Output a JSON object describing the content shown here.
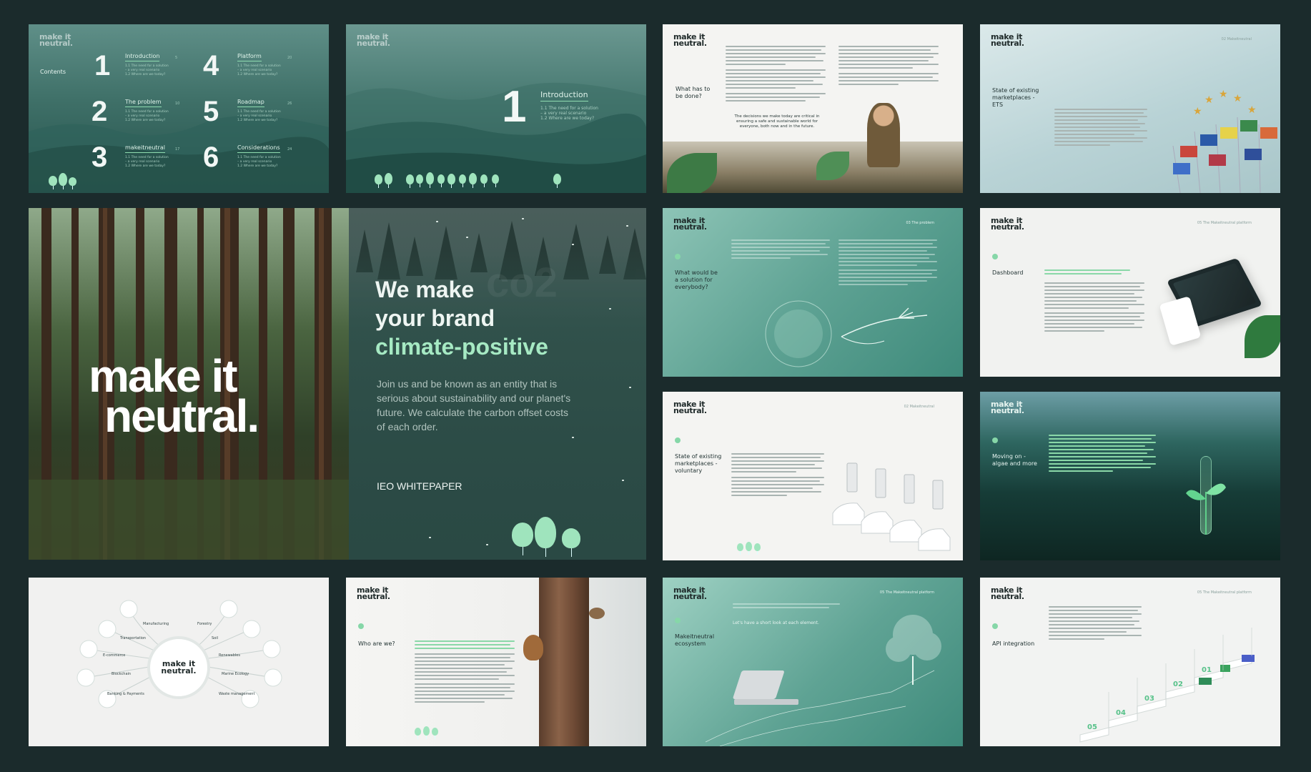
{
  "slides": {
    "contents": {
      "logo": [
        "make it",
        "neutral."
      ],
      "heading": "Contents",
      "items": [
        {
          "num": "1",
          "label": "Introduction",
          "page": "5",
          "sub": [
            "1.1  The need for a solution",
            "– a very real scenario",
            "1.2  Where are we today?"
          ]
        },
        {
          "num": "2",
          "label": "The problem",
          "page": "10",
          "sub": [
            "1.1  The need for a solution",
            "– a very real scenario",
            "1.2  Where are we today?"
          ]
        },
        {
          "num": "3",
          "label": "makeitneutral",
          "page": "17",
          "sub": [
            "1.1  The need for a solution",
            "– a very real scenario",
            "1.2  Where are we today?"
          ]
        },
        {
          "num": "4",
          "label": "Platform",
          "page": "20",
          "sub": [
            "1.1  The need for a solution",
            "– a very real scenario",
            "1.2  Where are we today?"
          ]
        },
        {
          "num": "5",
          "label": "Roadmap",
          "page": "26",
          "sub": [
            "1.1  The need for a solution",
            "– a very real scenario",
            "1.2  Where are we today?"
          ]
        },
        {
          "num": "6",
          "label": "Considerations",
          "page": "24",
          "sub": [
            "1.1  The need for a solution",
            "– a very real scenario",
            "1.2  Where are we today?"
          ]
        }
      ]
    },
    "intro": {
      "logo": [
        "make it",
        "neutral."
      ],
      "num": "1",
      "label": "Introduction",
      "sub": [
        "1.1  The need for a solution",
        "– a very real scenario",
        "1.2  Where are we today?"
      ]
    },
    "what_done": {
      "logo": [
        "make it",
        "neutral."
      ],
      "title": "What has to be done?",
      "quote": "The decisions we make today are critical in ensuring a safe and sustainable world for everyone, both now and in the future."
    },
    "ets": {
      "logo": [
        "make it",
        "neutral."
      ],
      "title": "State of existing marketplaces - ETS",
      "header": "02 Makeitneutral"
    },
    "hero": {
      "logo": [
        "make it",
        "neutral."
      ],
      "title_line1": "We make",
      "title_line2": "your brand",
      "title_line3": "climate-positive",
      "body": "Join us and be known as an entity that is serious about sustainability and our planet's future. We calculate the carbon offset costs of each order.",
      "tag": "IEO WHITEPAPER",
      "watermark": "co2"
    },
    "solution": {
      "logo": [
        "make it",
        "neutral."
      ],
      "title": "What would be a solution for everybody?",
      "header": "03 The problem"
    },
    "dashboard": {
      "logo": [
        "make it",
        "neutral."
      ],
      "title": "Dashboard",
      "header": "05 The Makeitneutral platform"
    },
    "voluntary": {
      "logo": [
        "make it",
        "neutral."
      ],
      "title": "State of existing marketplaces - voluntary",
      "header": "02 Makeitneutral"
    },
    "algae": {
      "logo": [
        "make it",
        "neutral."
      ],
      "title": "Moving on - algae and more"
    },
    "ecosystem_wheel": {
      "center": [
        "make it",
        "neutral."
      ],
      "left": [
        "Manufacturing",
        "Transportation",
        "E-commerce",
        "Blockchain",
        "Banking & Payments"
      ],
      "right": [
        "Forestry",
        "Soil",
        "Renewables",
        "Marine Ecology",
        "Waste management"
      ]
    },
    "who": {
      "logo": [
        "make it",
        "neutral."
      ],
      "title": "Who are we?"
    },
    "ecosystem": {
      "logo": [
        "make it",
        "neutral."
      ],
      "title": "Makeitneutral ecosystem",
      "header": "05 The Makeitneutral platform",
      "lead": "Let's have a short look at each element."
    },
    "api": {
      "logo": [
        "make it",
        "neutral."
      ],
      "title": "API integration",
      "header": "05 The Makeitneutral platform",
      "steps": [
        "05",
        "04",
        "03",
        "02",
        "01"
      ]
    }
  }
}
